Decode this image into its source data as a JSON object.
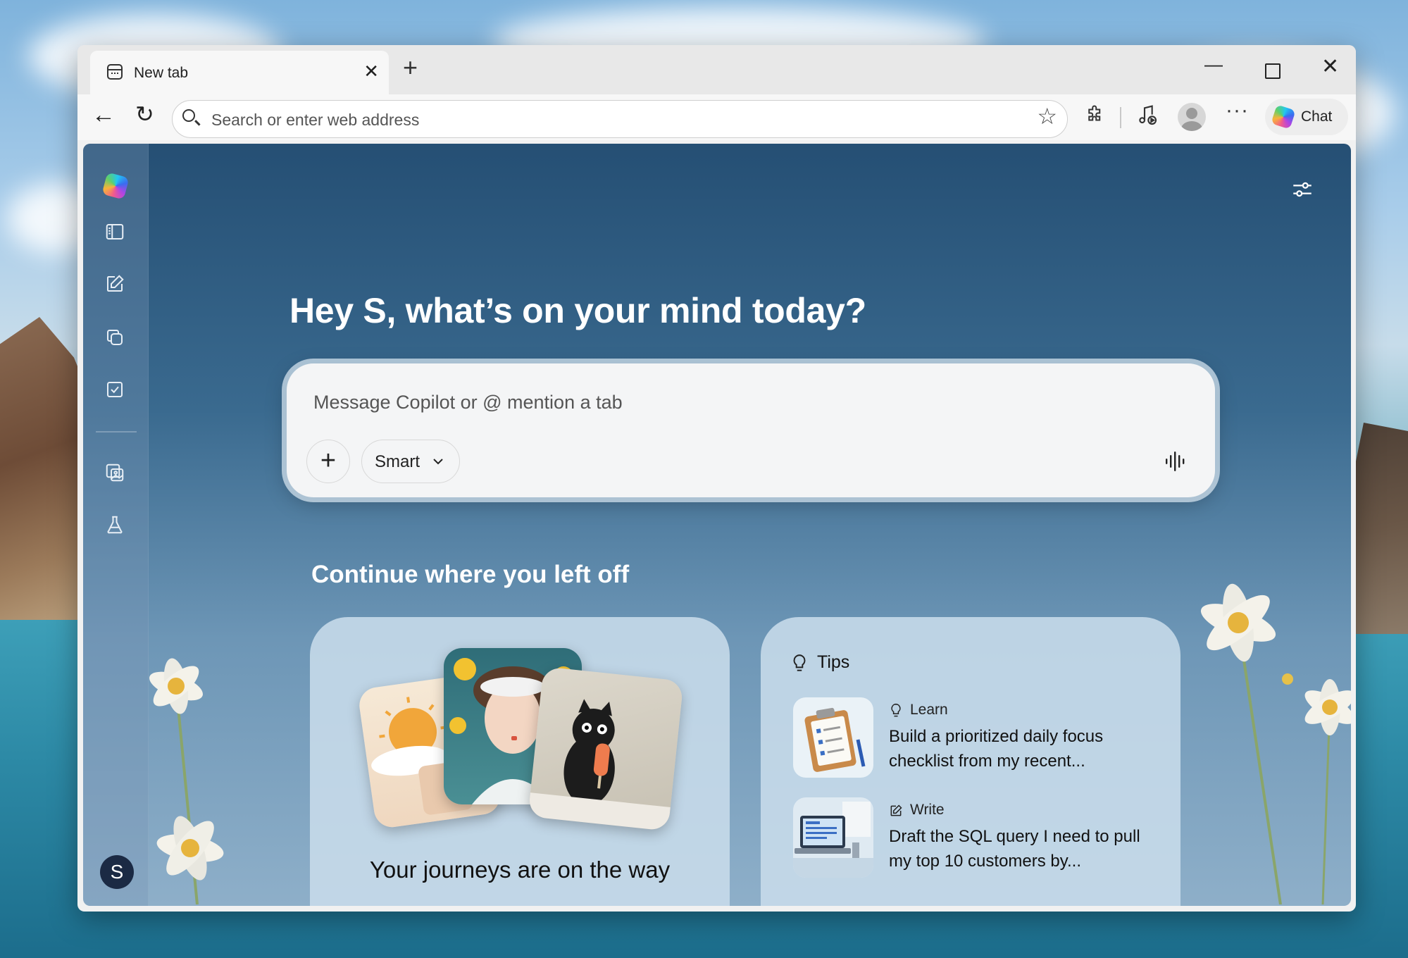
{
  "browser": {
    "tab": {
      "title": "New tab",
      "close": "✕"
    },
    "new_tab": "+",
    "window_buttons": {
      "minimize": "—",
      "close": "✕"
    },
    "address_bar": {
      "placeholder": "Search or enter web address"
    },
    "chat_button": {
      "label": "Chat"
    }
  },
  "copilot": {
    "greeting": "Hey S, what’s on your mind today?",
    "composer": {
      "placeholder": "Message Copilot or @ mention a tab",
      "add": "+",
      "mode": "Smart"
    },
    "user_initial": "S",
    "continue_section": {
      "title": "Continue where you left off",
      "journeys_caption": "Your journeys are on the way"
    },
    "tips": {
      "header": "Tips",
      "items": [
        {
          "kind": "Learn",
          "text": "Build a prioritized daily focus checklist from my recent..."
        },
        {
          "kind": "Write",
          "text": "Draft the SQL query I need to pull my top 10 customers by..."
        }
      ]
    }
  },
  "colors": {
    "content_top": "#254f74",
    "content_bottom": "#8eafc9",
    "card_bg": "#c8dcea",
    "avatar_bg": "#1b2a44"
  },
  "icons": [
    "tab-page-icon",
    "back-arrow-icon",
    "reload-icon",
    "search-icon",
    "favorite-star-icon",
    "extensions-icon",
    "media-control-icon",
    "profile-icon",
    "more-icon",
    "copilot-logo-icon",
    "sidebar-toggle-icon",
    "compose-icon",
    "pages-icon",
    "tasks-icon",
    "image-create-icon",
    "labs-flask-icon",
    "settings-sliders-icon",
    "voice-icon",
    "lightbulb-icon",
    "write-icon"
  ]
}
